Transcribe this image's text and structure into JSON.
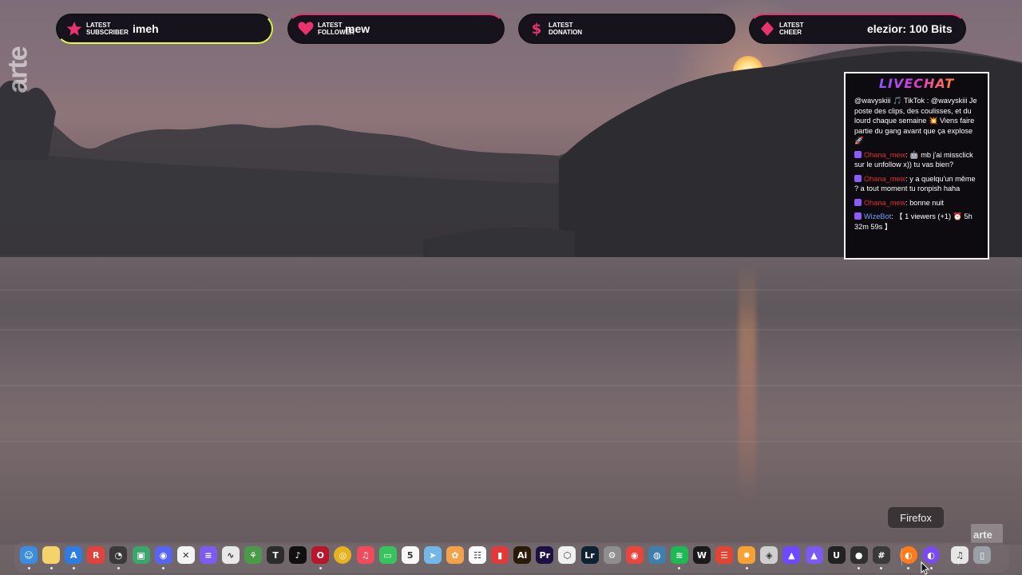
{
  "alerts": {
    "subscriber": {
      "label_line1": "LATEST",
      "label_line2": "SUBSCRIBER",
      "value": "imeh",
      "icon": "star-icon"
    },
    "follower": {
      "label_line1": "LATEST",
      "label_line2": "FOLLOWER",
      "value": "mew",
      "icon": "heart-icon"
    },
    "donation": {
      "label_line1": "LATEST",
      "label_line2": "DONATION",
      "value": "",
      "icon": "dollar-icon"
    },
    "cheer": {
      "label_line1": "LATEST",
      "label_line2": "CHEER",
      "value": "elezior: 100 Bits",
      "icon": "diamond-icon"
    }
  },
  "watermark": {
    "text": "arte",
    "corner_text": "arte"
  },
  "livechat": {
    "title": "LIVECHAT",
    "messages": [
      {
        "user": "",
        "text": "@wavyskiii 🎵 TikTok : @wavyskiii Je poste des clips, des coulisses, et du lourd chaque semaine 💥 Viens faire partie du gang avant que ça explose 🚀"
      },
      {
        "user": "Ohana_mew",
        "text": ": 🤖 mb j'ai missclick sur le unfollow x)) tu vas bien?"
      },
      {
        "user": "Ohana_mew",
        "text": ": y a quelqu'un même ? a tout moment tu ronpish haha"
      },
      {
        "user": "Ohana_mew",
        "text": ": bonne nuit"
      },
      {
        "user": "WizeBot",
        "text": ": 【 1 viewers (+1) ⏰ 5h 32m 59s 】"
      }
    ]
  },
  "dock": {
    "tooltip": "Firefox",
    "items": [
      {
        "name": "finder-icon",
        "glyph": "☺",
        "color": "#3b8de0"
      },
      {
        "name": "notes-icon",
        "glyph": "",
        "color": "#f3d36a"
      },
      {
        "name": "app-store-icon",
        "glyph": "A",
        "color": "#2f7de1"
      },
      {
        "name": "red-app-icon",
        "glyph": "R",
        "color": "#e2413c"
      },
      {
        "name": "activity-monitor-icon",
        "glyph": "◔",
        "color": "#3a3a3a"
      },
      {
        "name": "android-studio-icon",
        "glyph": "▣",
        "color": "#3ba56b"
      },
      {
        "name": "discord-icon",
        "glyph": "◉",
        "color": "#5865f2"
      },
      {
        "name": "capcut-icon",
        "glyph": "✕",
        "color": "#f4f4f4"
      },
      {
        "name": "notion-like-icon",
        "glyph": "≡",
        "color": "#7c5cf0"
      },
      {
        "name": "stocks-icon",
        "glyph": "∿",
        "color": "#e8e8e8"
      },
      {
        "name": "earth-app-icon",
        "glyph": "⚘",
        "color": "#4a9a4a"
      },
      {
        "name": "typst-icon",
        "glyph": "T",
        "color": "#2c2c2c"
      },
      {
        "name": "tiktok-icon",
        "glyph": "♪",
        "color": "#101010"
      },
      {
        "name": "opera-icon",
        "glyph": "O",
        "color": "#b8162a"
      },
      {
        "name": "chrome-icon",
        "glyph": "◎",
        "color": "#e8b21f"
      },
      {
        "name": "music-icon",
        "glyph": "♫",
        "color": "#f04a5d"
      },
      {
        "name": "messages-icon",
        "glyph": "▭",
        "color": "#38c35d"
      },
      {
        "name": "calendar-icon",
        "glyph": "5",
        "color": "#f8f8f8"
      },
      {
        "name": "maps-icon",
        "glyph": "➤",
        "color": "#73b6e8"
      },
      {
        "name": "photos-icon",
        "glyph": "✿",
        "color": "#f4a24a"
      },
      {
        "name": "reminders-icon",
        "glyph": "☷",
        "color": "#fafafa"
      },
      {
        "name": "red-tool-icon",
        "glyph": "▮",
        "color": "#e03a3a"
      },
      {
        "name": "illustrator-icon",
        "glyph": "Ai",
        "color": "#2a1a08"
      },
      {
        "name": "premiere-icon",
        "glyph": "Pr",
        "color": "#1c1044"
      },
      {
        "name": "unity-icon",
        "glyph": "⬡",
        "color": "#f0f0f0"
      },
      {
        "name": "lightroom-icon",
        "glyph": "Lr",
        "color": "#0f2231"
      },
      {
        "name": "system-settings-icon",
        "glyph": "⚙",
        "color": "#8e8e8e"
      },
      {
        "name": "screen-record-icon",
        "glyph": "◉",
        "color": "#e8463c"
      },
      {
        "name": "proxyman-icon",
        "glyph": "◍",
        "color": "#3f7fae"
      },
      {
        "name": "spotify-icon",
        "glyph": "≋",
        "color": "#1db954"
      },
      {
        "name": "waves-icon",
        "glyph": "W",
        "color": "#1a1a1a"
      },
      {
        "name": "todoist-icon",
        "glyph": "☰",
        "color": "#e44332"
      },
      {
        "name": "fl-studio-icon",
        "glyph": "✸",
        "color": "#f6a233"
      },
      {
        "name": "ableton-icon",
        "glyph": "◈",
        "color": "#cfcfcf"
      },
      {
        "name": "proton-icon",
        "glyph": "▲",
        "color": "#6d4aff"
      },
      {
        "name": "proton-vpn-icon",
        "glyph": "▲",
        "color": "#7a5af0"
      },
      {
        "name": "ue-icon",
        "glyph": "U",
        "color": "#222222"
      },
      {
        "name": "obs-icon",
        "glyph": "●",
        "color": "#2f2f2f"
      },
      {
        "name": "hashtag-app-icon",
        "glyph": "#",
        "color": "#3a3a3a"
      },
      {
        "name": "firefox-icon",
        "glyph": "◐",
        "color": "#ff7a1a"
      },
      {
        "name": "firefox-developer-icon",
        "glyph": "◐",
        "color": "#7a4cf0"
      },
      {
        "name": "itunes-file-icon",
        "glyph": "♫",
        "color": "#e6e6e6"
      },
      {
        "name": "trash-icon",
        "glyph": "▯",
        "color": "#9aa0a6"
      }
    ]
  }
}
